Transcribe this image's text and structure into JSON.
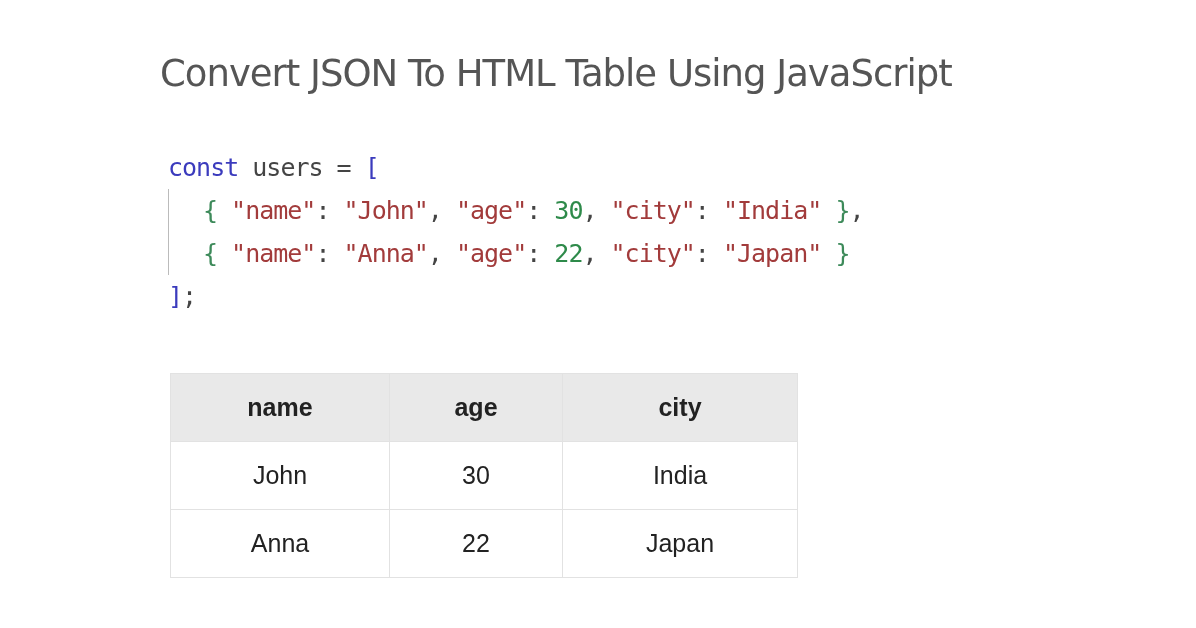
{
  "title": "Convert JSON To HTML Table Using JavaScript",
  "code": {
    "lines": [
      {
        "indented": false,
        "tokens": [
          {
            "kind": "keyword",
            "text": "const"
          },
          {
            "kind": "plain",
            "text": " users = "
          },
          {
            "kind": "bracket",
            "text": "["
          }
        ]
      },
      {
        "indented": true,
        "tokens": [
          {
            "kind": "brace",
            "text": "{ "
          },
          {
            "kind": "string",
            "text": "\"name\""
          },
          {
            "kind": "plain",
            "text": ": "
          },
          {
            "kind": "string",
            "text": "\"John\""
          },
          {
            "kind": "plain",
            "text": ", "
          },
          {
            "kind": "string",
            "text": "\"age\""
          },
          {
            "kind": "plain",
            "text": ": "
          },
          {
            "kind": "number",
            "text": "30"
          },
          {
            "kind": "plain",
            "text": ", "
          },
          {
            "kind": "string",
            "text": "\"city\""
          },
          {
            "kind": "plain",
            "text": ": "
          },
          {
            "kind": "string",
            "text": "\"India\""
          },
          {
            "kind": "brace",
            "text": " }"
          },
          {
            "kind": "plain",
            "text": ","
          }
        ]
      },
      {
        "indented": true,
        "tokens": [
          {
            "kind": "brace",
            "text": "{ "
          },
          {
            "kind": "string",
            "text": "\"name\""
          },
          {
            "kind": "plain",
            "text": ": "
          },
          {
            "kind": "string",
            "text": "\"Anna\""
          },
          {
            "kind": "plain",
            "text": ", "
          },
          {
            "kind": "string",
            "text": "\"age\""
          },
          {
            "kind": "plain",
            "text": ": "
          },
          {
            "kind": "number",
            "text": "22"
          },
          {
            "kind": "plain",
            "text": ", "
          },
          {
            "kind": "string",
            "text": "\"city\""
          },
          {
            "kind": "plain",
            "text": ": "
          },
          {
            "kind": "string",
            "text": "\"Japan\""
          },
          {
            "kind": "brace",
            "text": " }"
          }
        ]
      },
      {
        "indented": false,
        "tokens": [
          {
            "kind": "bracket",
            "text": "]"
          },
          {
            "kind": "plain",
            "text": ";"
          }
        ]
      }
    ]
  },
  "table": {
    "columns": [
      "name",
      "age",
      "city"
    ],
    "rows": [
      [
        "John",
        "30",
        "India"
      ],
      [
        "Anna",
        "22",
        "Japan"
      ]
    ]
  }
}
